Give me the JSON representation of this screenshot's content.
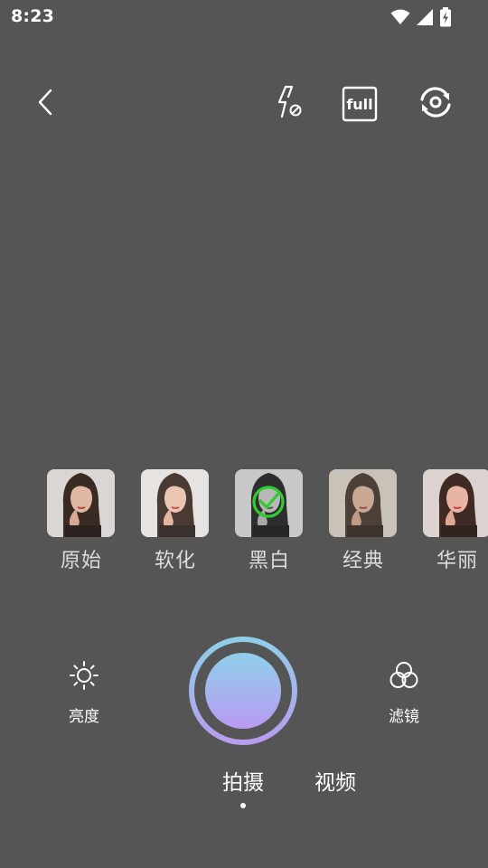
{
  "status_bar": {
    "time": "8:23",
    "icons": [
      "wifi-icon",
      "cellular-signal-icon",
      "battery-charging-icon"
    ]
  },
  "top_bar": {
    "back_icon": "chevron-left-icon",
    "flash_icon": "flash-off-icon",
    "ratio_label": "full",
    "switch_camera_icon": "switch-camera-icon"
  },
  "filters": [
    {
      "label": "原始",
      "style": "original"
    },
    {
      "label": "软化",
      "style": "soft"
    },
    {
      "label": "黑白",
      "style": "mono",
      "selected": true
    },
    {
      "label": "经典",
      "style": "classic"
    },
    {
      "label": "华丽",
      "style": "gorgeous"
    }
  ],
  "tools": {
    "brightness": {
      "label": "亮度",
      "icon": "sun-icon"
    },
    "filter": {
      "label": "滤镜",
      "icon": "overlapping-circles-icon"
    }
  },
  "modes": {
    "photo": "拍摄",
    "video": "视频",
    "active": "photo"
  },
  "colors": {
    "background": "#555555",
    "selected_indicator": "#2ecc2e",
    "shutter_gradient_top": "#8ecfe8",
    "shutter_gradient_bottom": "#b89cf0"
  }
}
